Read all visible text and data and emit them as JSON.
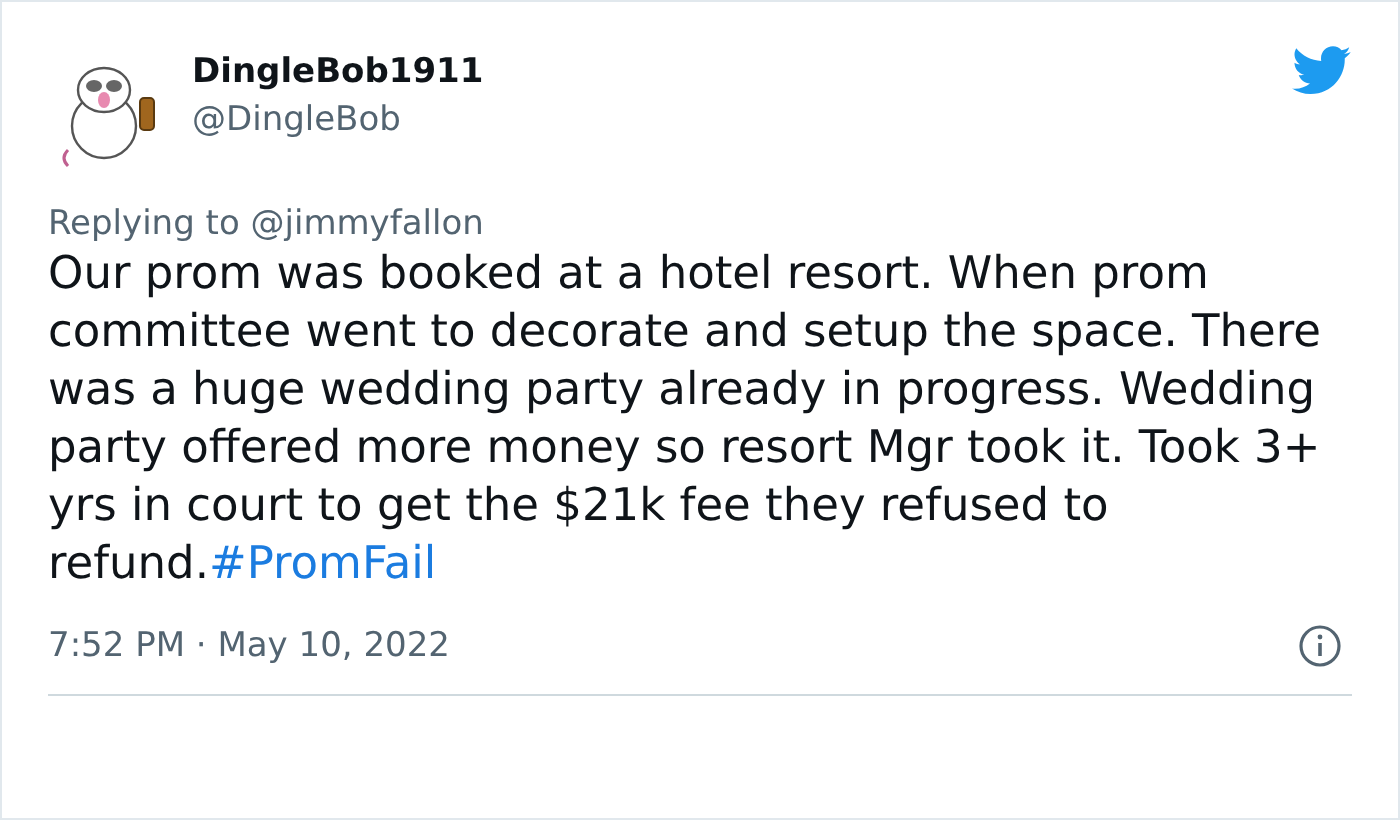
{
  "tweet": {
    "display_name": "DingleBob1911",
    "handle": "@DingleBob",
    "replying_to": "Replying to @jimmyfallon",
    "text": "Our prom was booked at a hotel resort. When prom  committee went to decorate and setup the space. There was a huge wedding party already in progress. Wedding party offered more money so resort Mgr took it. Took 3+ yrs in court to get the $21k fee they refused to refund.",
    "hashtag": "#PromFail",
    "timestamp": "7:52 PM · May 10, 2022"
  }
}
